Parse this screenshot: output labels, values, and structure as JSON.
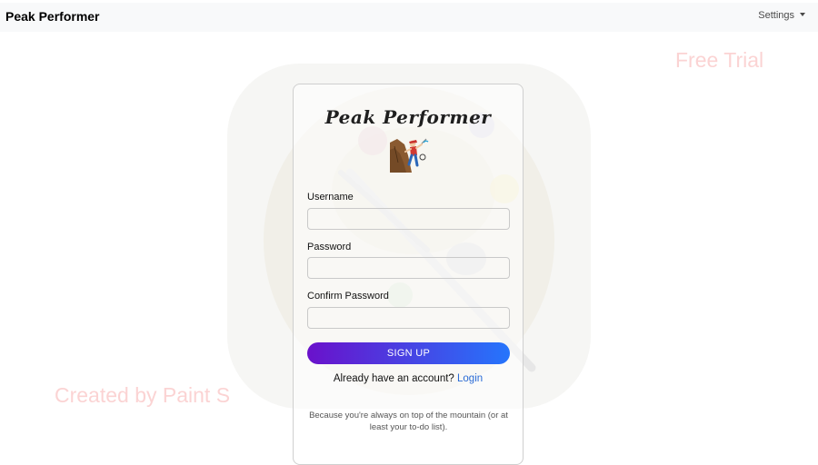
{
  "navbar": {
    "brand": "Peak Performer",
    "settings_label": "Settings"
  },
  "watermarks": {
    "top_right": "Free Trial",
    "bottom_left": "Created by Paint S"
  },
  "card": {
    "title": "Peak Performer",
    "logo_icon": "mountain-climber-icon"
  },
  "form": {
    "username_label": "Username",
    "username_value": "",
    "password_label": "Password",
    "password_value": "",
    "confirm_label": "Confirm Password",
    "confirm_value": "",
    "signup_label": "SIGN UP",
    "login_prompt": "Already have an account?",
    "login_link": "Login"
  },
  "tagline": "Because you're always on top of the mountain (or at least your to-do list).",
  "colors": {
    "navbar_bg": "#f8f9fa",
    "button_gradient_start": "#6a11cb",
    "button_gradient_end": "#2575fc",
    "link": "#2a6bd6",
    "watermark": "#f8afaf"
  }
}
